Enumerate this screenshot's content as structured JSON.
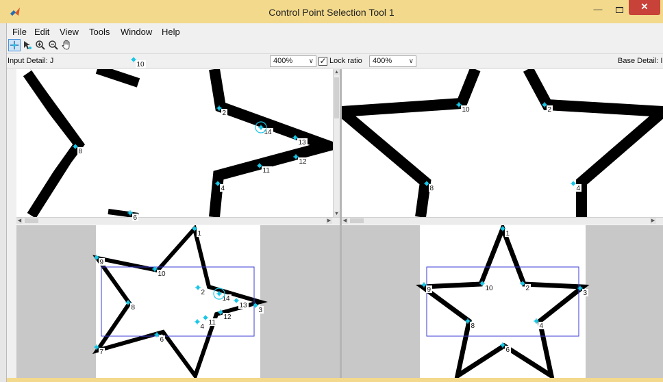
{
  "window": {
    "title": "Control Point Selection Tool 1",
    "close_glyph": "✕",
    "min_glyph": "—"
  },
  "menu": [
    "File",
    "Edit",
    "View",
    "Tools",
    "Window",
    "Help"
  ],
  "toolbar": {
    "tools": [
      "add-point-icon",
      "select-point-icon",
      "zoom-in-icon",
      "zoom-out-icon",
      "pan-hand-icon"
    ]
  },
  "options": {
    "input_detail_label": "Input Detail: J",
    "input_zoom": "400%",
    "lock_ratio_label": "Lock ratio",
    "lock_ratio_checked": true,
    "base_zoom": "400%",
    "base_detail_label": "Base Detail: I"
  },
  "points": {
    "input_detail": [
      "10",
      "2",
      "14",
      "13",
      "8",
      "12",
      "11",
      "4",
      "6"
    ],
    "base_detail": [
      "10",
      "2",
      "8",
      "4"
    ],
    "input_overview": [
      "1",
      "9",
      "10",
      "2",
      "14",
      "13",
      "8",
      "3",
      "12",
      "11",
      "4",
      "6",
      "7"
    ],
    "base_overview": [
      "1",
      "9",
      "10",
      "2",
      "3",
      "8",
      "4",
      "6"
    ]
  },
  "colors": {
    "title_bar": "#f3d98b",
    "close_button": "#c8423a",
    "control_point": "#19c6e6",
    "detail_rect": "#3b3bd6"
  }
}
